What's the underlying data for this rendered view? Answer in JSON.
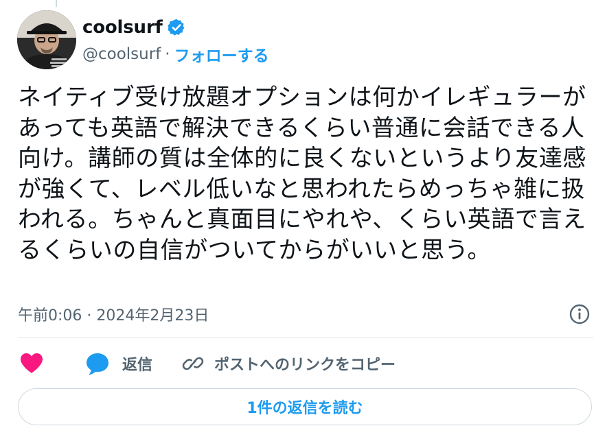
{
  "user": {
    "display_name": "coolsurf",
    "handle": "@coolsurf",
    "separator": "·",
    "follow_label": "フォローする"
  },
  "tweet": {
    "text": "ネイティブ受け放題オプションは何かイレギュラーがあっても英語で解決できるくらい普通に会話できる人向け。講師の質は全体的に良くないというより友達感が強くて、レベル低いなと思われたらめっちゃ雑に扱われる。ちゃんと真面目にやれや、くらい英語で言えるくらいの自信がついてからがいいと思う。",
    "timestamp": "午前0:06 · 2024年2月23日"
  },
  "actions": {
    "reply_label": "返信",
    "copy_link_label": "ポストへのリンクをコピー"
  },
  "read_replies_label": "1件の返信を読む",
  "colors": {
    "accent": "#1d9bf0",
    "like": "#f91880",
    "text": "#0f1419",
    "secondary": "#536471",
    "border": "#cfd9de"
  },
  "icons": {
    "verified": "verified-badge-icon",
    "info": "info-icon",
    "like": "heart-icon",
    "reply": "speech-bubble-icon",
    "link": "link-icon"
  }
}
